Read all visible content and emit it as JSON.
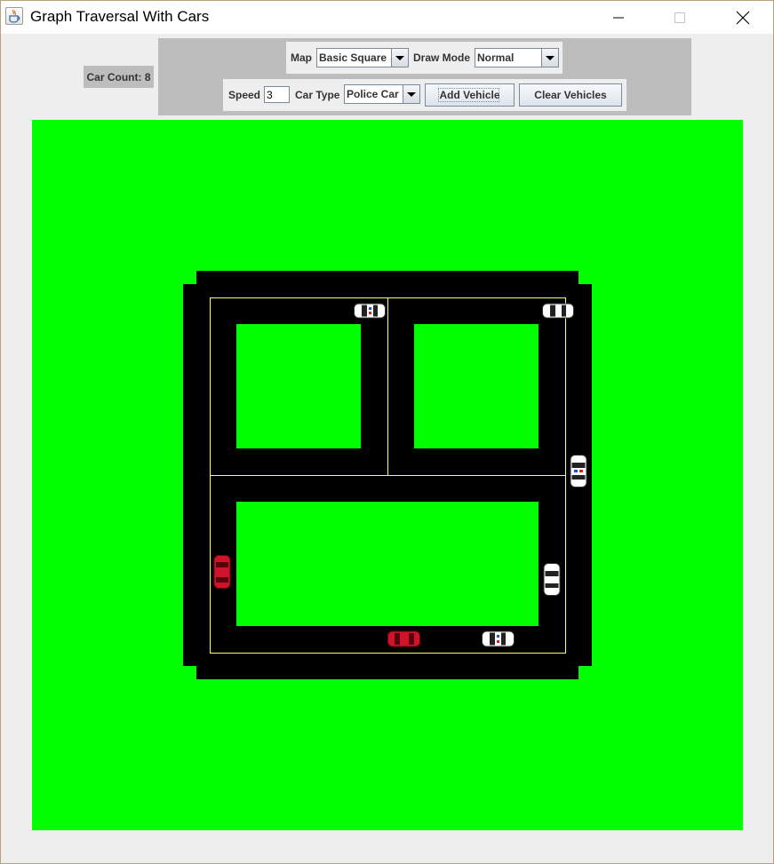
{
  "window": {
    "title": "Graph Traversal With Cars",
    "icons": {
      "app": "java-cup-icon",
      "minimize": "minimize-icon",
      "maximize": "maximize-icon",
      "close": "close-icon"
    }
  },
  "status": {
    "car_count": "Car Count: 8"
  },
  "controls": {
    "map_label": "Map",
    "map_value": "Basic Square",
    "draw_mode_label": "Draw Mode",
    "draw_mode_value": "Normal",
    "speed_label": "Speed",
    "speed_value": "3",
    "car_type_label": "Car Type",
    "car_type_value": "Police Car",
    "add_vehicle_label": "Add Vehicle",
    "clear_vehicles_label": "Clear Vehicles"
  },
  "map": {
    "colors": {
      "grass": "#00ff00",
      "road": "#000000",
      "lane_line": "#ffff66"
    },
    "cars": [
      {
        "type": "police-car",
        "color": "#ffffff",
        "direction": "east"
      },
      {
        "type": "police-car",
        "color": "#ffffff",
        "direction": "west"
      },
      {
        "type": "police-car",
        "color": "#ffffff",
        "direction": "north"
      },
      {
        "type": "sedan",
        "color": "#d0132b",
        "direction": "north"
      },
      {
        "type": "police-car",
        "color": "#ffffff",
        "direction": "south"
      },
      {
        "type": "sedan",
        "color": "#d0132b",
        "direction": "west"
      },
      {
        "type": "police-car",
        "color": "#ffffff",
        "direction": "east"
      },
      {
        "type": "police-car",
        "color": "#ffffff",
        "direction": "east"
      }
    ]
  }
}
